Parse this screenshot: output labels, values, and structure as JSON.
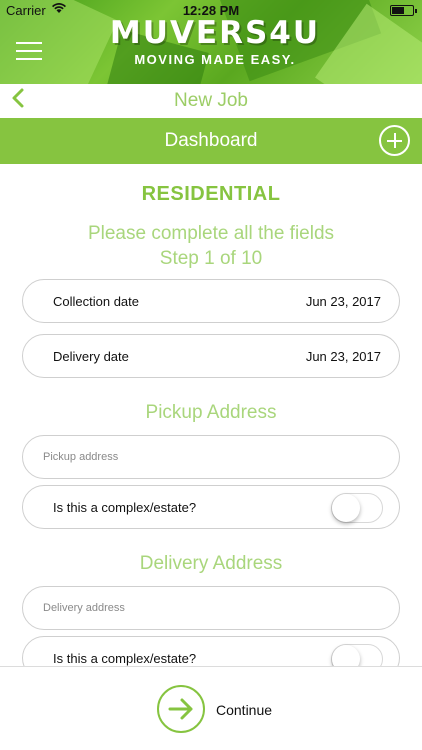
{
  "status_bar": {
    "carrier": "Carrier",
    "time": "12:28 PM"
  },
  "header": {
    "brand": "MUVERS4U",
    "tagline": "MOVING MADE EASY."
  },
  "nav": {
    "title": "New Job"
  },
  "dashboard": {
    "title": "Dashboard"
  },
  "form": {
    "type_heading": "RESIDENTIAL",
    "instruction": "Please complete all the fields",
    "step": "Step 1 of 10",
    "collection_date": {
      "label": "Collection date",
      "value": "Jun 23, 2017"
    },
    "delivery_date": {
      "label": "Delivery date",
      "value": "Jun 23, 2017"
    },
    "pickup": {
      "heading": "Pickup Address",
      "placeholder": "Pickup address",
      "complex_label": "Is this a complex/estate?",
      "complex_on": false
    },
    "delivery": {
      "heading": "Delivery Address",
      "placeholder": "Delivery address",
      "complex_label": "Is this a complex/estate?",
      "complex_on": false
    }
  },
  "footer": {
    "continue_label": "Continue"
  },
  "colors": {
    "accent": "#86c440",
    "accent_light": "#a9d67c"
  }
}
